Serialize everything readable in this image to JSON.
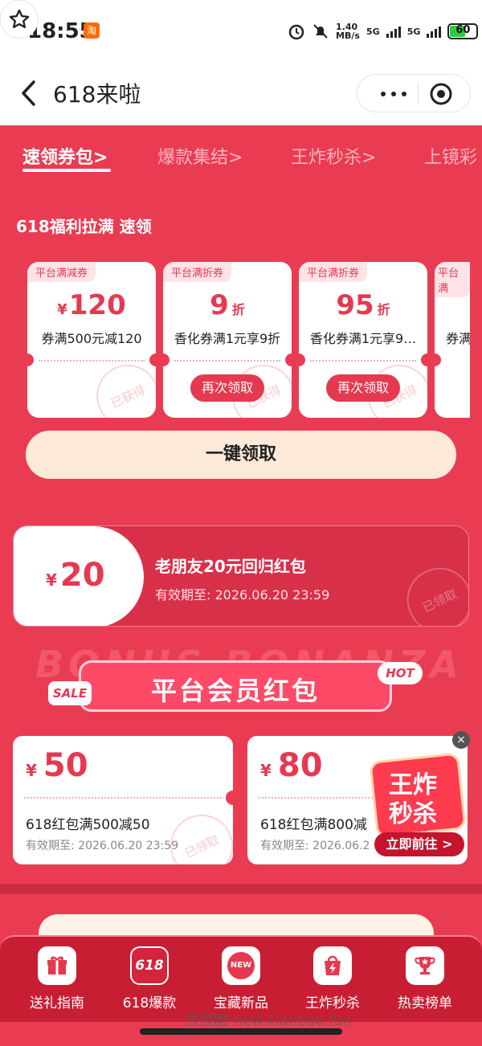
{
  "status": {
    "time": "18:55",
    "app_badge": "淘",
    "net_speed": "1.40\nMB/s",
    "net1": "5G",
    "net2": "5G",
    "battery": "60",
    "battery_level": 0.6
  },
  "nav": {
    "title": "618来啦"
  },
  "tabs": [
    "速领券包>",
    "爆款集结>",
    "王炸秒杀>",
    "上镜彩"
  ],
  "welfare": {
    "title": "618福利拉满 速领",
    "coupons": [
      {
        "tag": "平台满减券",
        "symbol": "¥",
        "amount": "120",
        "unit": "",
        "desc": "券满500元减120",
        "action": "",
        "stamp": "已获得"
      },
      {
        "tag": "平台满折券",
        "symbol": "",
        "amount": "9",
        "unit": "折",
        "desc": "香化券满1元享9折",
        "action": "再次领取",
        "stamp": "已获得"
      },
      {
        "tag": "平台满折券",
        "symbol": "",
        "amount": "95",
        "unit": "折",
        "desc": "香化券满1元享9…",
        "action": "再次领取",
        "stamp": "已获得"
      },
      {
        "tag": "平台满",
        "symbol": "¥",
        "amount": "",
        "unit": "",
        "desc": "券满",
        "action": "",
        "stamp": ""
      }
    ],
    "one_click": "一键领取"
  },
  "friend": {
    "symbol": "¥",
    "amount": "20",
    "title": "老朋友20元回归红包",
    "validity": "有效期至: 2026.06.20 23:59",
    "stamp": "已领取"
  },
  "member": {
    "bonus_bg": "BONUS BONANZA",
    "banner": "平台会员红包",
    "sale": "SALE",
    "hot": "HOT",
    "packets": [
      {
        "symbol": "¥",
        "amount": "50",
        "title": "618红包满500减50",
        "validity": "有效期至: 2026.06.20 23:59",
        "stamp": "已领取"
      },
      {
        "symbol": "¥",
        "amount": "80",
        "title": "618红包满800减",
        "validity": "有效期至: 2026.06.2"
      }
    ],
    "flash": {
      "line1": "王炸",
      "line2": "秒杀",
      "go": "立即前往 >",
      "close": "×"
    }
  },
  "tabbar": [
    {
      "label": "送礼指南",
      "icon": "gift-icon"
    },
    {
      "label": "618爆款",
      "icon": "618-icon",
      "icon_text": "618"
    },
    {
      "label": "宝藏新品",
      "icon": "new-badge-icon",
      "icon_text": "NEW"
    },
    {
      "label": "王炸秒杀",
      "icon": "lightning-bag-icon"
    },
    {
      "label": "热卖榜单",
      "icon": "trophy-icon"
    }
  ],
  "watermark": "线报酷-new.xianbao.fun",
  "colors": {
    "brand_red": "#e93c52",
    "coupon_red": "#e63950",
    "tabbar": "#c81e33",
    "button_cream": "#fde9d8"
  }
}
